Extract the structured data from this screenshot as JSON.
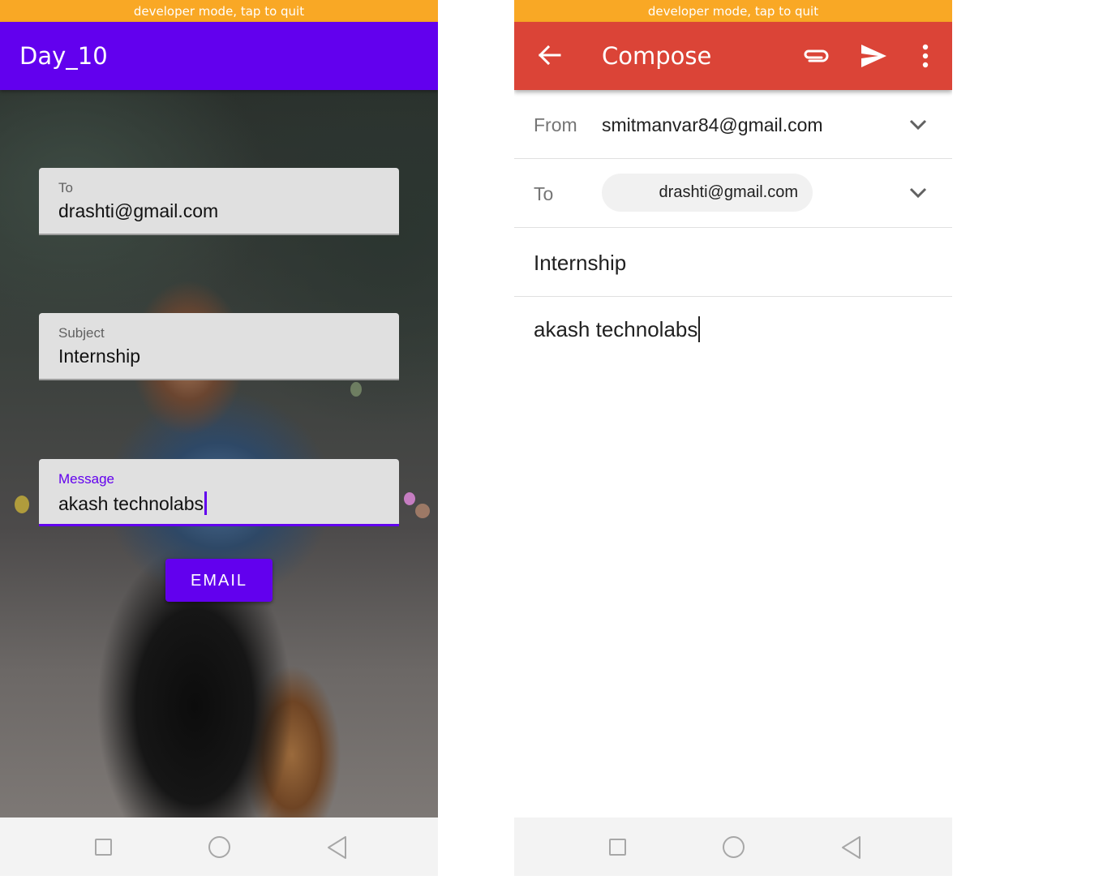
{
  "left_app": {
    "dev_banner": "developer mode, tap to quit",
    "title": "Day_10",
    "fields": {
      "to": {
        "label": "To",
        "value": "drashti@gmail.com"
      },
      "subject": {
        "label": "Subject",
        "value": "Internship"
      },
      "message": {
        "label": "Message",
        "value": "akash technolabs"
      }
    },
    "email_button": "EMAIL"
  },
  "right_app": {
    "dev_banner": "developer mode, tap to quit",
    "toolbar": {
      "title": "Compose",
      "icons": [
        "back-arrow-icon",
        "attach-icon",
        "send-icon",
        "more-vert-icon"
      ]
    },
    "from": {
      "label": "From",
      "value": "smitmanvar84@gmail.com"
    },
    "to": {
      "label": "To",
      "chip": "drashti@gmail.com"
    },
    "subject": "Internship",
    "body": "akash technolabs"
  },
  "nav_bar": {
    "icons": [
      "recents-square-icon",
      "home-circle-icon",
      "back-triangle-icon"
    ]
  },
  "colors": {
    "dev_banner": "#f9a825",
    "left_primary": "#6200ee",
    "compose_bar": "#db4437"
  }
}
